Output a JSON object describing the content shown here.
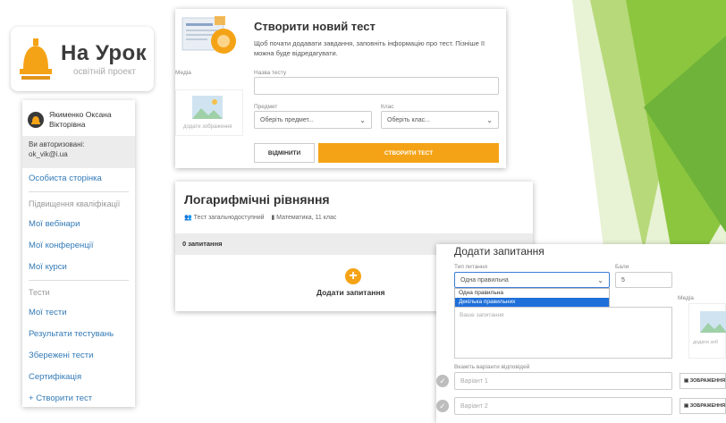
{
  "logo": {
    "title": "На Урок",
    "subtitle": "освітній проект"
  },
  "sidebar": {
    "user_name": "Якименко Оксана Вікторівна",
    "auth_label": "Ви авторизовані:",
    "auth_email": "ok_vik@i.ua",
    "personal_page": "Особиста сторінка",
    "section_qualification": "Підвищення кваліфікації",
    "items_qualification": [
      "Мої вебінари",
      "Мої конференції",
      "Мої курси"
    ],
    "section_tests": "Тести",
    "items_tests": [
      "Мої тести",
      "Результати тестувань",
      "Збережені тести",
      "Сертифікація"
    ],
    "create_test": "Створити тест"
  },
  "create_panel": {
    "title": "Створити новий тест",
    "description": "Щоб почати додавати завдання, заповніть інформацію про тест. Пізніше її можна буде відредагувати.",
    "media_label": "Медіа",
    "media_caption": "додати зображення",
    "name_label": "Назва тесту",
    "name_value": "",
    "subject_label": "Предмет",
    "subject_value": "Оберіть предмет...",
    "class_label": "Клас",
    "class_value": "Оберіть клас...",
    "cancel_label": "ВІДМІНИТИ",
    "create_label": "СТВОРИТИ ТЕСТ"
  },
  "test_panel": {
    "title": "Логарифмічні рівняння",
    "access": "Тест загальнодоступний",
    "subject": "Математика, 11 клас",
    "questions_count": "0 запитання",
    "add_label": "Додати запитання"
  },
  "question_panel": {
    "title": "Додати запитання",
    "type_label": "Тип питання",
    "type_value": "Одна правильна",
    "type_options": [
      "Одна правильна",
      "Декілька правильних"
    ],
    "score_label": "Бали",
    "score_value": "5",
    "media_label": "Медіа",
    "media_caption": "додати зоб",
    "question_placeholder": "Ваше запитання",
    "answers_label": "Вкажіть варіанти відповідей",
    "answer1_placeholder": "Варіант 1",
    "answer2_placeholder": "Варіант 2",
    "image_button": "ЗОБРАЖЕННЯ"
  }
}
